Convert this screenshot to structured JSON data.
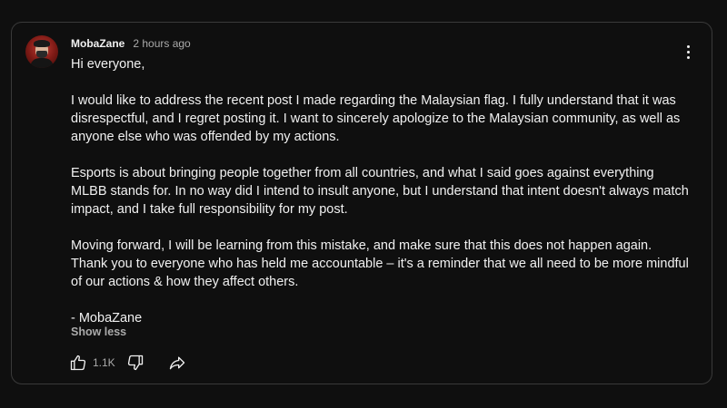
{
  "post": {
    "author": "MobaZane",
    "timestamp": "2 hours ago",
    "avatar_icon": "avatar",
    "body": {
      "greeting": "Hi everyone,",
      "paragraph_1": "I would like to address the recent post I made regarding the Malaysian flag. I fully understand that it was disrespectful, and I regret posting it. I want to sincerely apologize to the Malaysian community, as well as anyone else who was offended by my actions.",
      "paragraph_2": "Esports is about bringing people together from all countries, and what I said goes against everything MLBB stands for. In no way did I intend to insult anyone, but I understand that intent doesn't always match impact, and I take full responsibility for my post.",
      "paragraph_3": "Moving forward, I will be learning from this mistake, and make sure that this does not happen again. Thank you to everyone who has held me accountable – it's a reminder that we all need to be more mindful of our actions & how they affect others.",
      "signature": "- MobaZane"
    },
    "show_less_label": "Show less",
    "like_count": "1.1K",
    "icons": {
      "more": "more-vertical-icon",
      "like": "thumbs-up-icon",
      "dislike": "thumbs-down-icon",
      "share": "share-icon"
    }
  },
  "colors": {
    "background": "#0f0f0f",
    "border": "#3a3a3a",
    "text_primary": "#f1f1f1",
    "text_secondary": "#aaaaaa"
  }
}
